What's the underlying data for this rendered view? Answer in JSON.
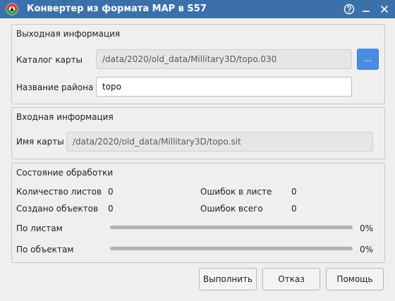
{
  "window": {
    "title": "Конвертер из формата MAP в S57",
    "icons": {
      "app": "app-logo-icon",
      "help": "help-icon",
      "minimize": "minimize-icon",
      "close": "close-icon"
    }
  },
  "output_group": {
    "title": "Выходная информация",
    "catalog_label": "Каталог карты",
    "catalog_value": "/data/2020/old_data/Millitary3D/topo.030",
    "browse_label": "...",
    "district_label": "Название района",
    "district_value": "topo"
  },
  "input_group": {
    "title": "Входная информация",
    "map_name_label": "Имя карты",
    "map_name_value": "/data/2020/old_data/Millitary3D/topo.sit"
  },
  "status_group": {
    "title": "Состояние обработки",
    "sheet_count_label": "Количество листов",
    "sheet_count_value": "0",
    "sheet_errors_label": "Ошибок в листе",
    "sheet_errors_value": "0",
    "objects_created_label": "Создано объектов",
    "objects_created_value": "0",
    "total_errors_label": "Ошибок всего",
    "total_errors_value": "0",
    "by_sheets_label": "По листам",
    "by_sheets_percent": "0%",
    "by_sheets_progress": 0,
    "by_objects_label": "По объектам",
    "by_objects_percent": "0%",
    "by_objects_progress": 0
  },
  "buttons": {
    "run": "Выполнить",
    "cancel": "Отказ",
    "help": "Помощь"
  },
  "colors": {
    "titlebar": "#3c70ab",
    "accent_button": "#4a8de0",
    "window_bg": "#efefef",
    "progress_track": "#b1b1b1"
  }
}
